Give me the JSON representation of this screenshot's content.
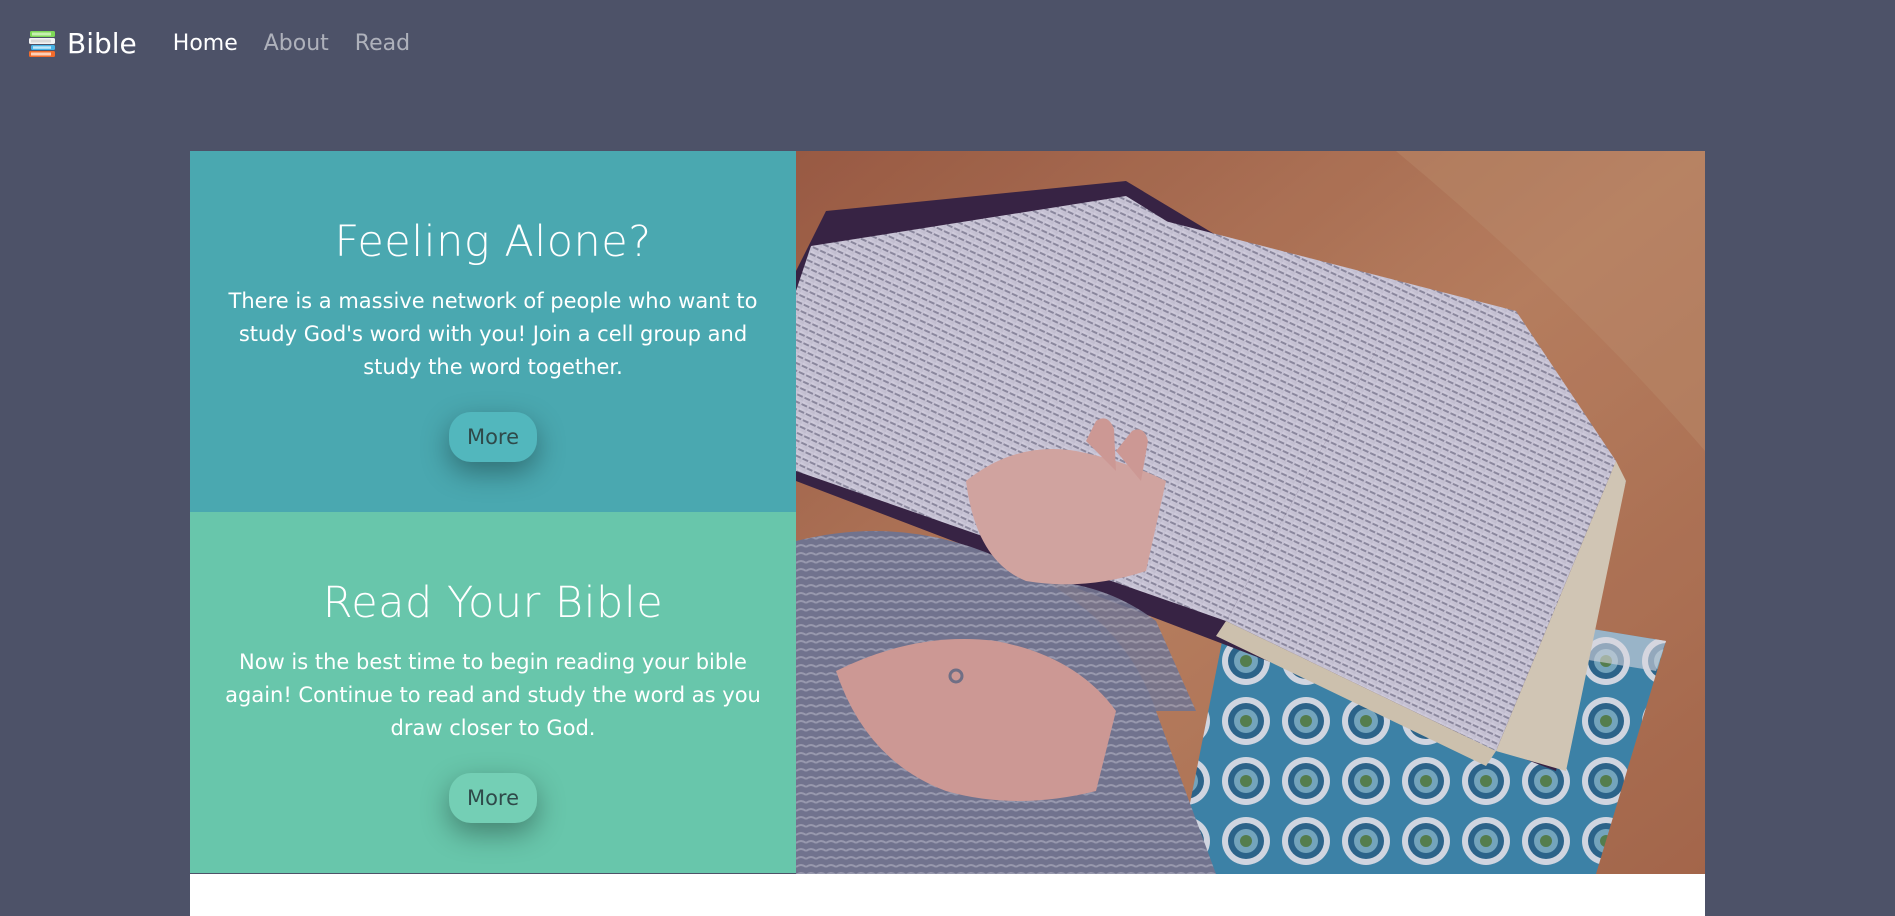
{
  "navbar": {
    "brand": "Bible",
    "brand_icon": "books-icon",
    "links": [
      {
        "label": "Home",
        "active": true
      },
      {
        "label": "About",
        "active": false
      },
      {
        "label": "Read",
        "active": false
      }
    ]
  },
  "cards": [
    {
      "title": "Feeling Alone?",
      "text": "There is a massive network of people who want to study God's word with you! Join a cell group and study the word together.",
      "button": "More",
      "color": "#4aa8b0"
    },
    {
      "title": "Read Your Bible",
      "text": "Now is the best time to begin reading your bible again! Continue to read and study the word as you draw closer to God.",
      "button": "More",
      "color": "#68c6ab"
    }
  ],
  "colors": {
    "background": "#4d5268",
    "accent_teal": "#4aa8b0",
    "accent_green": "#68c6ab"
  }
}
